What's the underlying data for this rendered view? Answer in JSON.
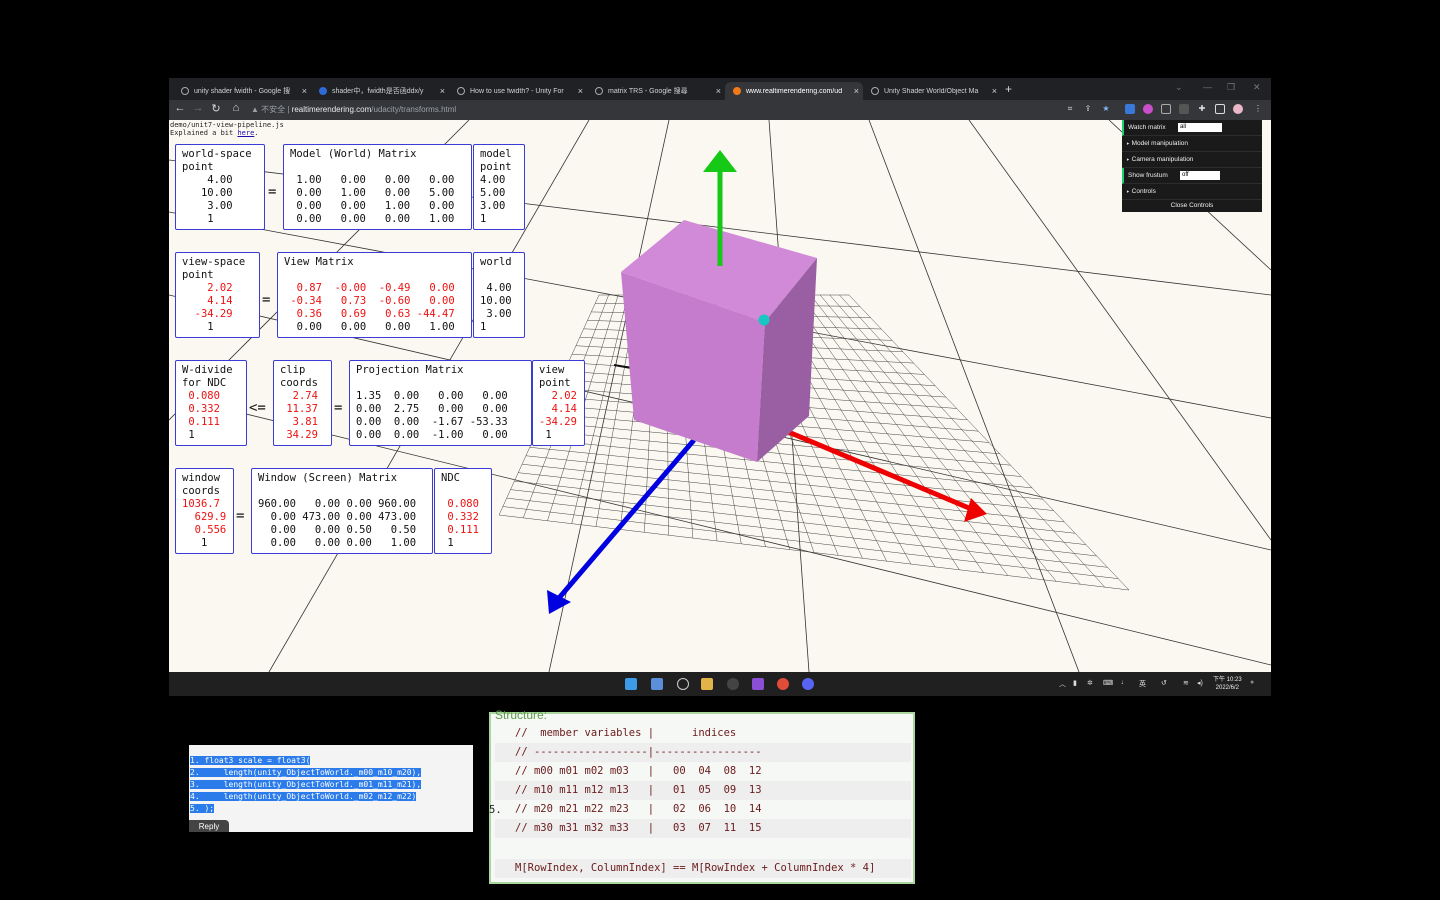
{
  "browser": {
    "tabs": [
      {
        "title": "unity shader fwidth - Google 搜",
        "close": "×"
      },
      {
        "title": "shader中，fwidth是否函ddx/y",
        "close": "×"
      },
      {
        "title": "How to use fwidth? - Unity For",
        "close": "×"
      },
      {
        "title": "matrix TRS - Google 搜尋",
        "close": "×"
      },
      {
        "title": "www.realtimerendering.com/ud",
        "close": "×"
      },
      {
        "title": "Unity Shader World/Object Ma",
        "close": "×"
      }
    ],
    "new_tab": "+",
    "security_label": "▲ 不安全",
    "url_host": "realtimerendering.com",
    "url_path": "/udacity/transforms.html"
  },
  "page": {
    "source_file": "demo/unit7-view-pipeline.js",
    "explain_prefix": "Explained a bit ",
    "explain_link": "here",
    "explain_suffix": "."
  },
  "matrices": {
    "world_point": {
      "head": "world-space\npoint",
      "rows": [
        "    4.00",
        "   10.00",
        "    3.00",
        "    1"
      ]
    },
    "model_matrix": {
      "head": "Model (World) Matrix",
      "rows": [
        " 1.00   0.00   0.00   0.00",
        " 0.00   1.00   0.00   5.00",
        " 0.00   0.00   1.00   0.00",
        " 0.00   0.00   0.00   1.00"
      ]
    },
    "model_point": {
      "head": "model\npoint",
      "rows": [
        "4.00",
        "5.00",
        "3.00",
        "1"
      ]
    },
    "view_point": {
      "head": "view-space\npoint",
      "rows": [
        "    2.02",
        "    4.14",
        "  -34.29",
        "    1"
      ]
    },
    "view_matrix": {
      "head": "View Matrix",
      "rows": [
        "  0.87  -0.00  -0.49   0.00",
        " -0.34   0.73  -0.60   0.00",
        "  0.36   0.69   0.63 -44.47",
        "  0.00   0.00   0.00   1.00"
      ]
    },
    "world_vec": {
      "head": "world",
      "rows": [
        " 4.00",
        "10.00",
        " 3.00",
        "1"
      ]
    },
    "wdivide": {
      "head": "W-divide\nfor NDC",
      "rows": [
        " 0.080",
        " 0.332",
        " 0.111",
        " 1"
      ]
    },
    "clip": {
      "head": "clip\ncoords",
      "rows": [
        "  2.74",
        " 11.37",
        "  3.81",
        " 34.29"
      ]
    },
    "projection_matrix": {
      "head": "Projection Matrix",
      "rows": [
        "1.35  0.00   0.00   0.00",
        "0.00  2.75   0.00   0.00",
        "0.00  0.00  -1.67 -53.33",
        "0.00  0.00  -1.00   0.00"
      ]
    },
    "view_vec": {
      "head": "view\npoint",
      "rows": [
        "  2.02",
        "  4.14",
        "-34.29",
        " 1"
      ]
    },
    "window_coords": {
      "head": "window\ncoords",
      "rows": [
        "1036.7",
        "  629.9",
        "  0.556",
        "   1"
      ]
    },
    "window_matrix": {
      "head": "Window (Screen) Matrix",
      "rows": [
        "960.00   0.00 0.00 960.00",
        "  0.00 473.00 0.00 473.00",
        "  0.00   0.00 0.50   0.50",
        "  0.00   0.00 0.00   1.00"
      ]
    },
    "ndc": {
      "head": "NDC",
      "rows": [
        " 0.080",
        " 0.332",
        " 0.111",
        " 1"
      ]
    },
    "ops": {
      "eq": "=",
      "leq": "<="
    }
  },
  "controls": {
    "watch_label": "Watch matrix",
    "watch_value": "all",
    "model_manip": "Model manipulation",
    "camera_manip": "Camera manipulation",
    "frustum_label": "Show frustum",
    "frustum_value": "off",
    "controls_label": "Controls",
    "close_label": "Close Controls"
  },
  "taskbar": {
    "ime": "英",
    "time": "下午 10:23",
    "date": "2022/6/2"
  },
  "snippet1": {
    "lines": [
      "1. float3 scale = float3(",
      "2.     length(unity_ObjectToWorld._m00_m10_m20),",
      "3.     length(unity_ObjectToWorld._m01_m11_m21),",
      "4.     length(unity_ObjectToWorld._m02_m12_m22)",
      "5. );"
    ],
    "reply": "Reply"
  },
  "snippet2": {
    "title": "Structure:",
    "lines": [
      "//  member variables |      indices",
      "// ------------------|-----------------",
      "// m00 m01 m02 m03   |   00  04  08  12",
      "// m10 m11 m12 m13   |   01  05  09  13",
      "// m20 m21 m22 m23   |   02  06  10  14",
      "// m30 m31 m32 m33   |   03  07  11  15",
      "",
      "M[RowIndex, ColumnIndex] == M[RowIndex + ColumnIndex * 4]"
    ],
    "gutter_five": "5."
  }
}
